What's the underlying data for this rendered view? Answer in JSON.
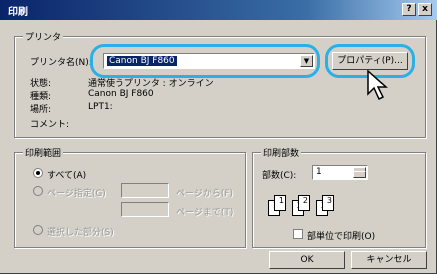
{
  "window": {
    "title": "印刷",
    "help_btn": "?",
    "close_btn": "x"
  },
  "printer": {
    "group_label": "プリンタ",
    "name_label": "プリンタ名(N):",
    "name_value": "Canon BJ F860",
    "properties_button": "プロパティ(P)...",
    "status_label": "状態:",
    "status_value": "通常使うプリンタ : オンライン",
    "type_label": "種類:",
    "type_value": "Canon BJ F860",
    "location_label": "場所:",
    "location_value": "LPT1:",
    "comment_label": "コメント:"
  },
  "range": {
    "group_label": "印刷範囲",
    "all_label": "すべて(A)",
    "pages_label": "ページ指定(G)",
    "from_label": "ページから(F)",
    "to_label": "ページまで(T)",
    "selection_label": "選択した部分(S)"
  },
  "copies": {
    "group_label": "印刷部数",
    "count_label": "部数(C):",
    "count_value": "1",
    "collate_label": "部単位で印刷(O)",
    "pages": [
      "1",
      "1",
      "2",
      "2",
      "3",
      "3"
    ]
  },
  "footer": {
    "ok_label": "OK",
    "cancel_label": "キャンセル"
  },
  "colors": {
    "highlight": "#2ab0e6",
    "title_bar": "#0a246a"
  }
}
